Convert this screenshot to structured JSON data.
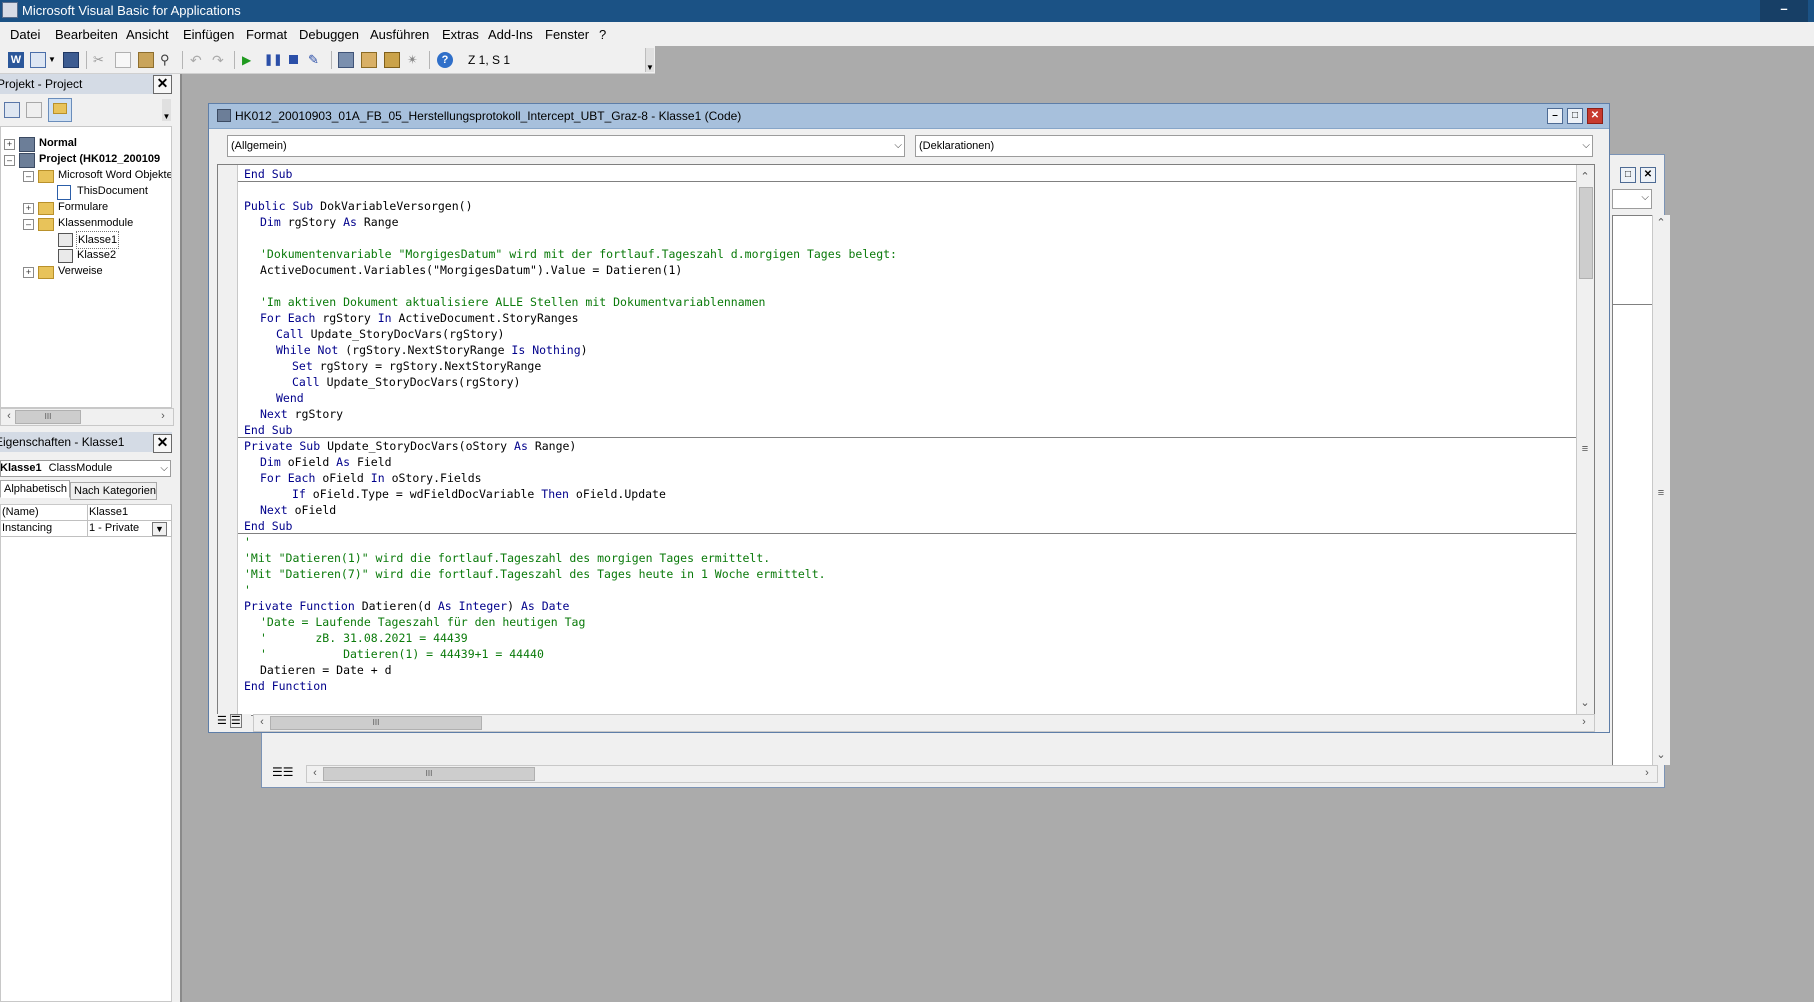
{
  "app": {
    "title": "Microsoft Visual Basic for Applications"
  },
  "menu": [
    "Datei",
    "Bearbeiten",
    "Ansicht",
    "Einfügen",
    "Format",
    "Debuggen",
    "Ausführen",
    "Extras",
    "Add-Ins",
    "Fenster",
    "?"
  ],
  "toolbar": {
    "cursor_position": "Z 1, S 1"
  },
  "project_pane": {
    "title": "Projekt - Project",
    "tree": {
      "normal": "Normal",
      "project": "Project (HK012_200109",
      "word_objects": "Microsoft Word Objekte",
      "this_document": "ThisDocument",
      "forms": "Formulare",
      "class_modules": "Klassenmodule",
      "class1": "Klasse1",
      "class2": "Klasse2",
      "references": "Verweise"
    }
  },
  "properties_pane": {
    "title": "Eigenschaften - Klasse1",
    "object_selector": {
      "name": "Klasse1",
      "type": "ClassModule"
    },
    "tabs": [
      "Alphabetisch",
      "Nach Kategorien"
    ],
    "rows": [
      {
        "name": "(Name)",
        "value": "Klasse1"
      },
      {
        "name": "Instancing",
        "value": "1 - Private"
      }
    ]
  },
  "code_window": {
    "title": "HK012_20010903_01A_FB_05_Herstellungsprotokoll_Intercept_UBT_Graz-8 - Klasse1 (Code)",
    "object_dropdown": "(Allgemein)",
    "procedure_dropdown": "(Deklarationen)",
    "lines": [
      {
        "indent": 0,
        "segments": [
          {
            "t": "End Sub",
            "k": "kw"
          }
        ]
      },
      {
        "indent": 0,
        "segments": []
      },
      {
        "indent": 0,
        "segments": [
          {
            "t": "Public Sub ",
            "k": "kw"
          },
          {
            "t": "DokVariableVersorgen()",
            "k": ""
          }
        ]
      },
      {
        "indent": 1,
        "segments": [
          {
            "t": "Dim ",
            "k": "kw"
          },
          {
            "t": "rgStory ",
            "k": ""
          },
          {
            "t": "As ",
            "k": "kw"
          },
          {
            "t": "Range",
            "k": ""
          }
        ]
      },
      {
        "indent": 0,
        "segments": []
      },
      {
        "indent": 1,
        "segments": [
          {
            "t": "'Dokumentenvariable \"MorgigesDatum\" wird mit der fortlauf.Tageszahl d.morgigen Tages belegt:",
            "k": "cm"
          }
        ]
      },
      {
        "indent": 1,
        "segments": [
          {
            "t": "ActiveDocument.Variables(\"MorgigesDatum\").Value = Datieren(1)",
            "k": ""
          }
        ]
      },
      {
        "indent": 0,
        "segments": []
      },
      {
        "indent": 1,
        "segments": [
          {
            "t": "'Im aktiven Dokument aktualisiere ALLE Stellen mit Dokumentvariablennamen",
            "k": "cm"
          }
        ]
      },
      {
        "indent": 1,
        "segments": [
          {
            "t": "For Each ",
            "k": "kw"
          },
          {
            "t": "rgStory ",
            "k": ""
          },
          {
            "t": "In ",
            "k": "kw"
          },
          {
            "t": "ActiveDocument.StoryRanges",
            "k": ""
          }
        ]
      },
      {
        "indent": 2,
        "segments": [
          {
            "t": "Call ",
            "k": "kw"
          },
          {
            "t": "Update_StoryDocVars(rgStory)",
            "k": ""
          }
        ]
      },
      {
        "indent": 2,
        "segments": [
          {
            "t": "While Not ",
            "k": "kw"
          },
          {
            "t": "(rgStory.NextStoryRange ",
            "k": ""
          },
          {
            "t": "Is Nothing",
            "k": "kw"
          },
          {
            "t": ")",
            "k": ""
          }
        ]
      },
      {
        "indent": 3,
        "segments": [
          {
            "t": "Set ",
            "k": "kw"
          },
          {
            "t": "rgStory = rgStory.NextStoryRange",
            "k": ""
          }
        ]
      },
      {
        "indent": 3,
        "segments": [
          {
            "t": "Call ",
            "k": "kw"
          },
          {
            "t": "Update_StoryDocVars(rgStory)",
            "k": ""
          }
        ]
      },
      {
        "indent": 2,
        "segments": [
          {
            "t": "Wend",
            "k": "kw"
          }
        ]
      },
      {
        "indent": 1,
        "segments": [
          {
            "t": "Next ",
            "k": "kw"
          },
          {
            "t": "rgStory",
            "k": ""
          }
        ]
      },
      {
        "indent": 0,
        "segments": [
          {
            "t": "End Sub",
            "k": "kw"
          }
        ],
        "sep_after": true
      },
      {
        "indent": 0,
        "segments": [
          {
            "t": "Private Sub ",
            "k": "kw"
          },
          {
            "t": "Update_StoryDocVars(oStory ",
            "k": ""
          },
          {
            "t": "As ",
            "k": "kw"
          },
          {
            "t": "Range)",
            "k": ""
          }
        ]
      },
      {
        "indent": 1,
        "segments": [
          {
            "t": "Dim ",
            "k": "kw"
          },
          {
            "t": "oField ",
            "k": ""
          },
          {
            "t": "As ",
            "k": "kw"
          },
          {
            "t": "Field",
            "k": ""
          }
        ]
      },
      {
        "indent": 1,
        "segments": [
          {
            "t": "For Each ",
            "k": "kw"
          },
          {
            "t": "oField ",
            "k": ""
          },
          {
            "t": "In ",
            "k": "kw"
          },
          {
            "t": "oStory.Fields",
            "k": ""
          }
        ]
      },
      {
        "indent": 3,
        "segments": [
          {
            "t": "If ",
            "k": "kw"
          },
          {
            "t": "oField.Type = wdFieldDocVariable ",
            "k": ""
          },
          {
            "t": "Then ",
            "k": "kw"
          },
          {
            "t": "oField.Update",
            "k": ""
          }
        ]
      },
      {
        "indent": 1,
        "segments": [
          {
            "t": "Next ",
            "k": "kw"
          },
          {
            "t": "oField",
            "k": ""
          }
        ]
      },
      {
        "indent": 0,
        "segments": [
          {
            "t": "End Sub",
            "k": "kw"
          }
        ],
        "sep_after": true
      },
      {
        "indent": 0,
        "segments": [
          {
            "t": "'",
            "k": "cm"
          }
        ]
      },
      {
        "indent": 0,
        "segments": [
          {
            "t": "'Mit \"Datieren(1)\" wird die fortlauf.Tageszahl des morgigen Tages ermittelt.",
            "k": "cm"
          }
        ]
      },
      {
        "indent": 0,
        "segments": [
          {
            "t": "'Mit \"Datieren(7)\" wird die fortlauf.Tageszahl des Tages heute in 1 Woche ermittelt.",
            "k": "cm"
          }
        ]
      },
      {
        "indent": 0,
        "segments": [
          {
            "t": "'",
            "k": "cm"
          }
        ]
      },
      {
        "indent": 0,
        "segments": [
          {
            "t": "Private Function ",
            "k": "kw"
          },
          {
            "t": "Datieren(d ",
            "k": ""
          },
          {
            "t": "As Integer",
            "k": "kw"
          },
          {
            "t": ") ",
            "k": ""
          },
          {
            "t": "As Date",
            "k": "kw"
          }
        ]
      },
      {
        "indent": 1,
        "segments": [
          {
            "t": "'Date = Laufende Tageszahl für den heutigen Tag",
            "k": "cm"
          }
        ]
      },
      {
        "indent": 1,
        "segments": [
          {
            "t": "'       zB. 31.08.2021 = 44439",
            "k": "cm"
          }
        ]
      },
      {
        "indent": 1,
        "segments": [
          {
            "t": "'           Datieren(1) = 44439+1 = 44440",
            "k": "cm"
          }
        ]
      },
      {
        "indent": 1,
        "segments": [
          {
            "t": "Datieren = Date + d",
            "k": ""
          }
        ]
      },
      {
        "indent": 0,
        "segments": [
          {
            "t": "End Function",
            "k": "kw"
          }
        ]
      }
    ]
  }
}
